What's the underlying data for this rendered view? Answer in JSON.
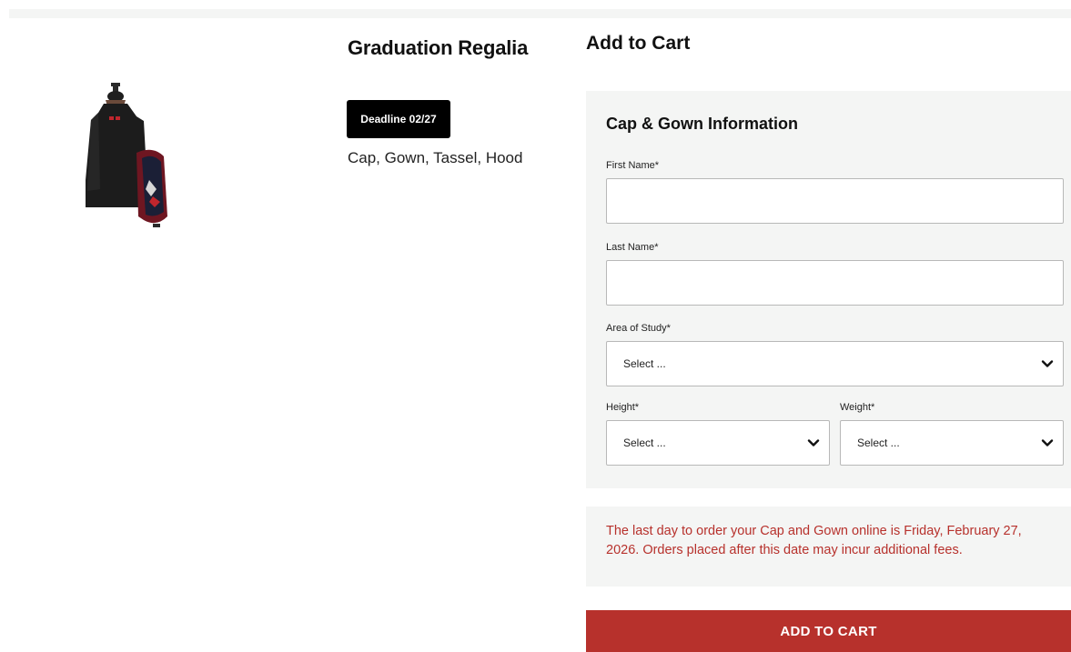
{
  "product": {
    "title": "Graduation Regalia",
    "badge": "Deadline 02/27",
    "description": "Cap, Gown, Tassel, Hood",
    "image_icon": "gown-with-hood-image"
  },
  "cart": {
    "heading": "Add to Cart",
    "form": {
      "heading": "Cap & Gown Information",
      "first_name": {
        "label": "First Name*",
        "value": ""
      },
      "last_name": {
        "label": "Last Name*",
        "value": ""
      },
      "area_of_study": {
        "label": "Area of Study*",
        "selected": "Select ..."
      },
      "height": {
        "label": "Height*",
        "selected": "Select ..."
      },
      "weight": {
        "label": "Weight*",
        "selected": "Select ..."
      }
    },
    "notice": "The last day to order your Cap and Gown online is Friday, February 27, 2026. Orders placed after this date may incur additional fees.",
    "button_label": "ADD TO CART"
  },
  "colors": {
    "accent": "#b7312c",
    "panel_bg": "#f4f5f4",
    "badge_bg": "#000000"
  }
}
